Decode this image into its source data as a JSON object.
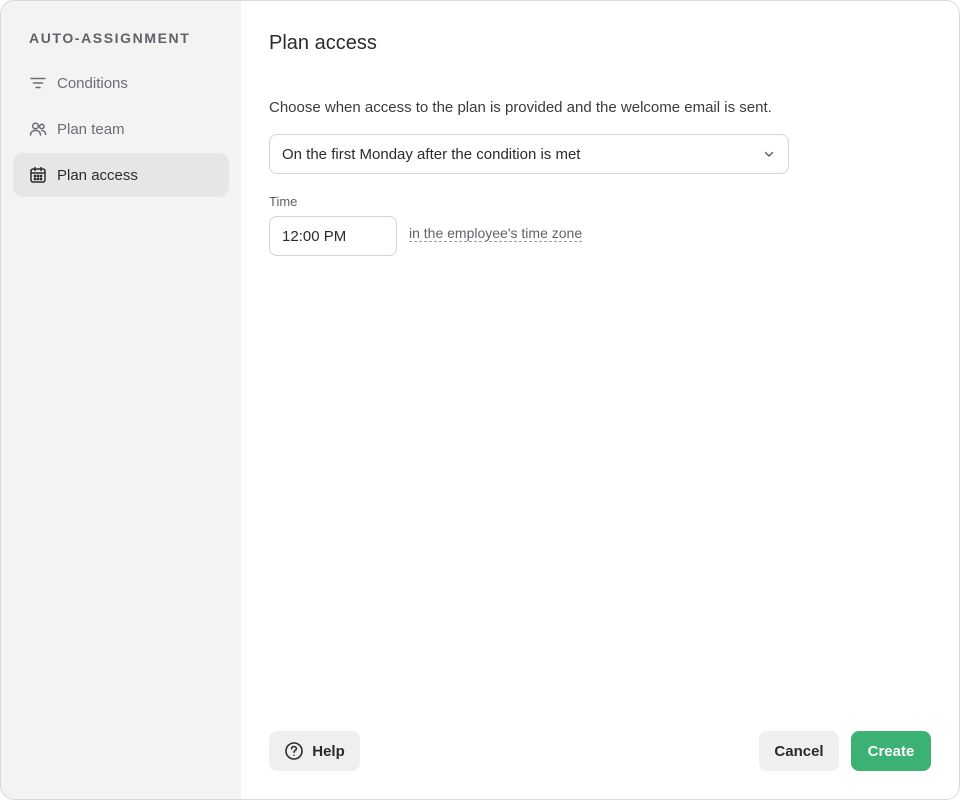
{
  "sidebar": {
    "title": "AUTO-ASSIGNMENT",
    "items": [
      {
        "label": "Conditions",
        "icon": "filter-lines-icon",
        "active": false
      },
      {
        "label": "Plan team",
        "icon": "users-icon",
        "active": false
      },
      {
        "label": "Plan access",
        "icon": "calendar-icon",
        "active": true
      }
    ]
  },
  "main": {
    "title": "Plan access",
    "description": "Choose when access to the plan is provided and the welcome email is sent.",
    "access_select": {
      "selected": "On the first Monday after the condition is met"
    },
    "time": {
      "label": "Time",
      "value": "12:00 PM",
      "timezone_link": "in the employee's time zone"
    }
  },
  "footer": {
    "help_label": "Help",
    "cancel_label": "Cancel",
    "create_label": "Create"
  },
  "colors": {
    "sidebar_bg": "#f3f3f3",
    "active_item_bg": "#e6e6e6",
    "primary_green": "#3bb273",
    "secondary_button_bg": "#efefef"
  }
}
